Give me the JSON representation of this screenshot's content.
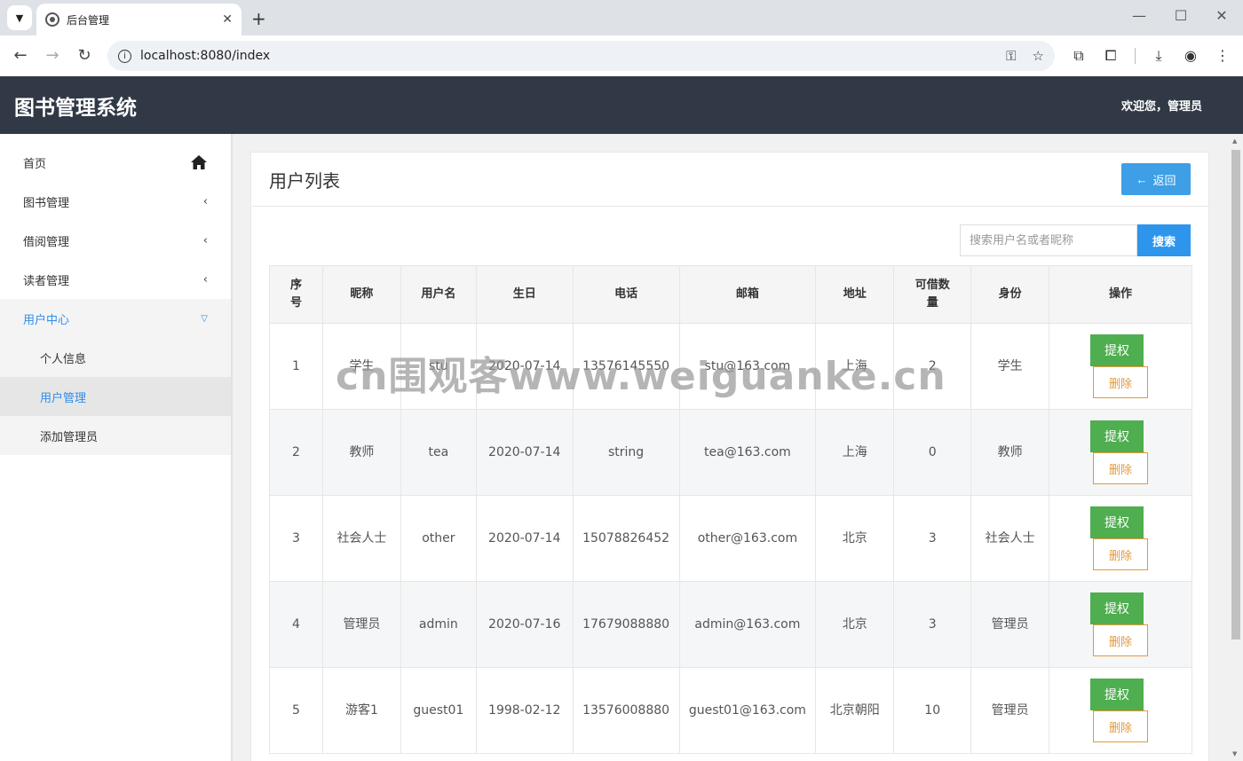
{
  "browser": {
    "tab_title": "后台管理",
    "url": "localhost:8080/index"
  },
  "header": {
    "title": "图书管理系统",
    "welcome": "欢迎您，管理员"
  },
  "sidebar": {
    "items": [
      {
        "label": "首页"
      },
      {
        "label": "图书管理"
      },
      {
        "label": "借阅管理"
      },
      {
        "label": "读者管理"
      },
      {
        "label": "用户中心"
      }
    ],
    "sub_items": [
      {
        "label": "个人信息"
      },
      {
        "label": "用户管理"
      },
      {
        "label": "添加管理员"
      }
    ]
  },
  "panel": {
    "title": "用户列表",
    "back_label": "返回",
    "search_placeholder": "搜索用户名或者昵称",
    "search_label": "搜索"
  },
  "table": {
    "headers": [
      "序号",
      "昵称",
      "用户名",
      "生日",
      "电话",
      "邮箱",
      "地址",
      "可借数量",
      "身份",
      "操作"
    ],
    "rows": [
      {
        "id": "1",
        "nickname": "学生",
        "username": "stu",
        "birthday": "2020-07-14",
        "phone": "13576145550",
        "email": "stu@163.com",
        "address": "上海",
        "quota": "2",
        "role": "学生"
      },
      {
        "id": "2",
        "nickname": "教师",
        "username": "tea",
        "birthday": "2020-07-14",
        "phone": "string",
        "email": "tea@163.com",
        "address": "上海",
        "quota": "0",
        "role": "教师"
      },
      {
        "id": "3",
        "nickname": "社会人士",
        "username": "other",
        "birthday": "2020-07-14",
        "phone": "15078826452",
        "email": "other@163.com",
        "address": "北京",
        "quota": "3",
        "role": "社会人士"
      },
      {
        "id": "4",
        "nickname": "管理员",
        "username": "admin",
        "birthday": "2020-07-16",
        "phone": "17679088880",
        "email": "admin@163.com",
        "address": "北京",
        "quota": "3",
        "role": "管理员"
      },
      {
        "id": "5",
        "nickname": "游客1",
        "username": "guest01",
        "birthday": "1998-02-12",
        "phone": "13576008880",
        "email": "guest01@163.com",
        "address": "北京朝阳",
        "quota": "10",
        "role": "管理员"
      }
    ],
    "grant_label": "提权",
    "delete_label": "删除"
  },
  "watermark": "cn围观客www.weiguanke.cn"
}
